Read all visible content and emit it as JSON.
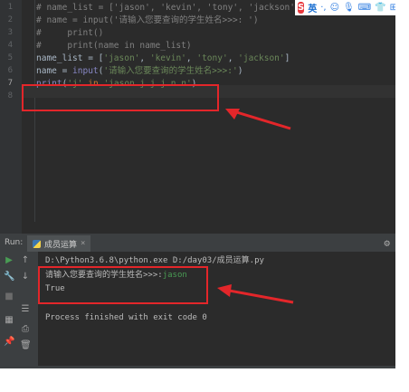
{
  "editor": {
    "line_numbers": [
      "1",
      "2",
      "3",
      "4",
      "5",
      "6",
      "7",
      "8"
    ],
    "current_line": "7",
    "code": [
      [
        {
          "t": "comment",
          "v": "# name_list = ['jason', 'kevin', 'tony', 'jackson']"
        }
      ],
      [
        {
          "t": "comment",
          "v": "# name = input('请输入您要查询的学生姓名>>>: ')"
        }
      ],
      [
        {
          "t": "comment",
          "v": "#     print()"
        }
      ],
      [
        {
          "t": "comment",
          "v": "#     print(name in name_list)"
        }
      ],
      [
        {
          "t": "plain",
          "v": "name_list = ["
        },
        {
          "t": "str",
          "v": "'jason'"
        },
        {
          "t": "plain",
          "v": ", "
        },
        {
          "t": "str",
          "v": "'kevin'"
        },
        {
          "t": "plain",
          "v": ", "
        },
        {
          "t": "str",
          "v": "'tony'"
        },
        {
          "t": "plain",
          "v": ", "
        },
        {
          "t": "str",
          "v": "'jackson'"
        },
        {
          "t": "plain",
          "v": "]"
        }
      ],
      [
        {
          "t": "plain",
          "v": "name = "
        },
        {
          "t": "fn",
          "v": "input"
        },
        {
          "t": "plain",
          "v": "("
        },
        {
          "t": "str",
          "v": "'请输入您要查询的学生姓名>>>:'"
        },
        {
          "t": "plain",
          "v": ")"
        }
      ],
      [
        {
          "t": "fn",
          "v": "print"
        },
        {
          "t": "plain",
          "v": "("
        },
        {
          "t": "str",
          "v": "'j'"
        },
        {
          "t": "plain",
          "v": " "
        },
        {
          "t": "kw",
          "v": "in"
        },
        {
          "t": "plain",
          "v": " "
        },
        {
          "t": "str",
          "v": "'jason j j j n n'"
        },
        {
          "t": "plain",
          "v": ")"
        }
      ],
      []
    ]
  },
  "ime_toolbar": {
    "logo": "S",
    "language": "英",
    "icons": [
      "punctuation-icon",
      "emoji-icon",
      "microphone-icon",
      "keyboard-icon",
      "skin-icon",
      "grid-icon"
    ],
    "glyphs": [
      "·,",
      "☺",
      "🎙",
      "⌨",
      "👕",
      "⊞"
    ]
  },
  "run_panel": {
    "label": "Run:",
    "tab_title": "成员运算",
    "close_glyph": "×",
    "settings_glyph": "⚙"
  },
  "console": {
    "command": "D:\\Python3.6.8\\python.exe D:/day03/成员运算.py",
    "prompt": "请输入您要查询的学生姓名>>>:",
    "user_input": "jason",
    "result": "True",
    "finish": "Process finished with exit code 0"
  },
  "colors": {
    "background": "#2b2b2b",
    "annotation": "#e3262a",
    "string": "#6a8759",
    "keyword": "#cc7832",
    "comment": "#808080",
    "input_text": "#499c54"
  }
}
